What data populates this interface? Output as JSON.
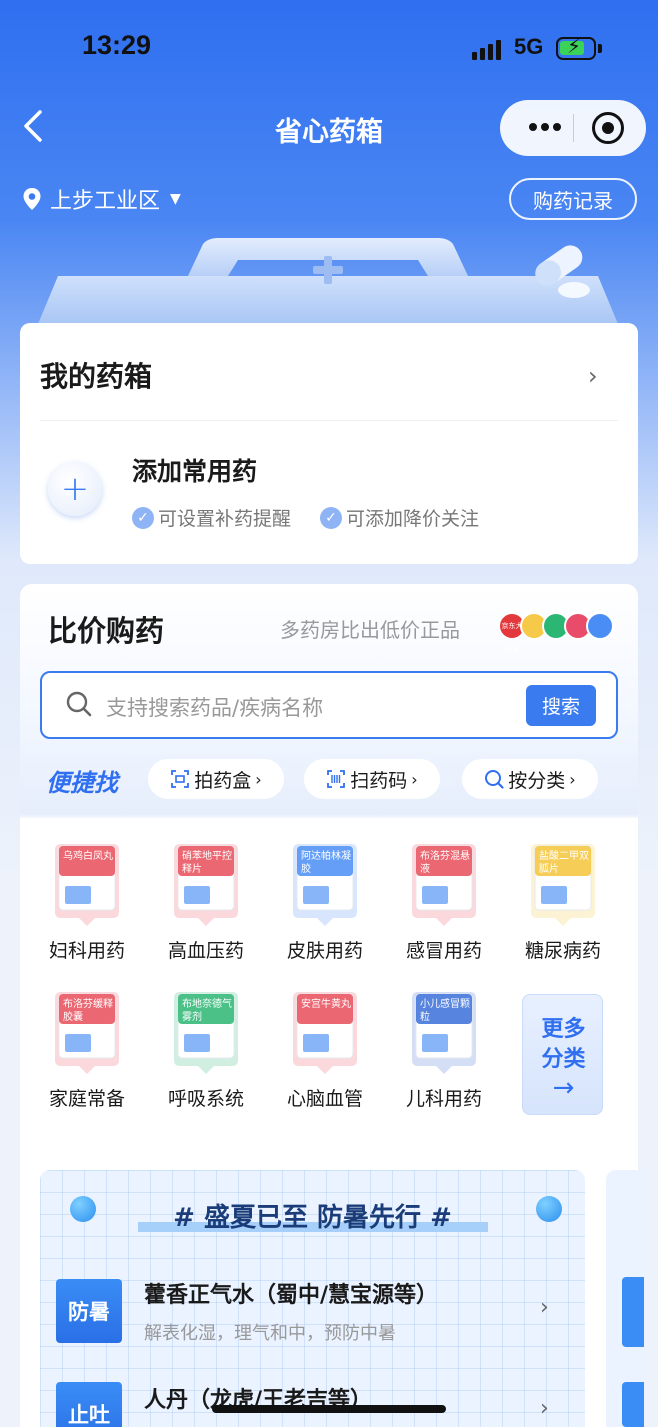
{
  "status_bar": {
    "time": "13:29",
    "network": "5G"
  },
  "nav": {
    "title": "省心药箱"
  },
  "location": {
    "name": "上步工业区"
  },
  "records_button": "购药记录",
  "my_box": {
    "title": "我的药箱",
    "add_title": "添加常用药",
    "features": [
      "可设置补药提醒",
      "可添加降价关注"
    ]
  },
  "compare": {
    "title": "比价购药",
    "subtitle": "多药房比出低价正品",
    "pharmacy_logos": [
      {
        "label": "京东大药房",
        "color": "#e4393c"
      },
      {
        "label": "",
        "color": "#f7c948"
      },
      {
        "label": "",
        "color": "#2bb673"
      },
      {
        "label": "",
        "color": "#e94b6a"
      },
      {
        "label": "",
        "color": "#4a8df5"
      }
    ],
    "search_placeholder": "支持搜索药品/疾病名称",
    "search_button": "搜索",
    "quick_label": "便捷找",
    "quick_chips": [
      "拍药盒",
      "扫药码",
      "按分类"
    ]
  },
  "categories": [
    {
      "label": "妇科用药",
      "box_text": "乌鸡白凤丸",
      "color": "#e84d5b"
    },
    {
      "label": "高血压药",
      "box_text": "硝苯地平控释片",
      "color": "#e84d5b"
    },
    {
      "label": "皮肤用药",
      "box_text": "阿达帕林凝胶",
      "color": "#4a8df5"
    },
    {
      "label": "感冒用药",
      "box_text": "布洛芬混悬液",
      "color": "#e84d5b"
    },
    {
      "label": "糖尿病药",
      "box_text": "盐酸二甲双胍片",
      "color": "#f3c43a"
    },
    {
      "label": "家庭常备",
      "box_text": "布洛芬缓释胶囊",
      "color": "#e84d5b"
    },
    {
      "label": "呼吸系统",
      "box_text": "布地奈德气雾剂",
      "color": "#2bb673"
    },
    {
      "label": "心脑血管",
      "box_text": "安宫牛黄丸",
      "color": "#e84d5b"
    },
    {
      "label": "儿科用药",
      "box_text": "小儿感冒颗粒",
      "color": "#3a6fd8"
    }
  ],
  "more_categories": {
    "line1": "更多",
    "line2": "分类",
    "arrow": "→"
  },
  "promo": {
    "title": "# 盛夏已至 防暑先行 #",
    "items": [
      {
        "tag": "防暑",
        "name": "藿香正气水（蜀中/慧宝源等）",
        "desc": "解表化湿，理气和中，预防中暑"
      },
      {
        "tag": "止吐",
        "name": "人丹（龙虎/王老吉等）",
        "desc": ""
      }
    ]
  }
}
